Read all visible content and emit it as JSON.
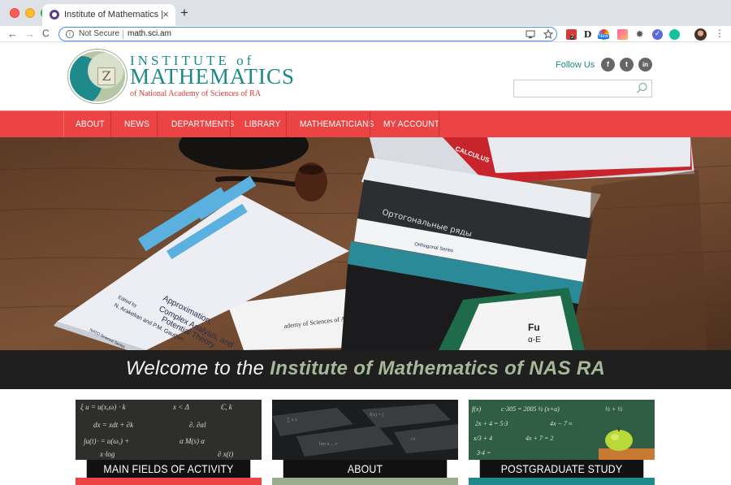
{
  "browser": {
    "tab_title": "Institute of Mathematics |",
    "tab_close": "×",
    "new_tab": "+",
    "back": "←",
    "forward": "→",
    "reload": "C",
    "info_glyph": "i",
    "security_label": "Not Secure",
    "url": "math.sci.am",
    "extensions": [
      "ext-red",
      "ext-disconnect",
      "ext-new",
      "ext-gradient",
      "ext-gear",
      "ext-check",
      "ext-grammarly",
      "avatar"
    ],
    "badges": {
      "ext_red": "2",
      "ext_new": "New"
    },
    "menu": "⋮"
  },
  "header": {
    "logo_line1": "INSTITUTE of",
    "logo_line2": "MATHEMATICS",
    "logo_line3": "of National Academy of Sciences of RA",
    "logo_glyph": "Z",
    "follow_us": "Follow Us",
    "social": [
      "f",
      "t",
      "in"
    ],
    "search_placeholder": ""
  },
  "nav": {
    "items": [
      "ABOUT",
      "NEWS",
      "DEPARTMENTS",
      "LIBRARY",
      "MATHEMATICIANS",
      "MY ACCOUNT"
    ]
  },
  "hero": {
    "book1_title": "Approximation, Complex Analysis, and Potential Theory",
    "book1_authors": "N. Arakelian and P.M. Gauthier",
    "book1_edited": "Edited by",
    "book1_series": "NATO Science Series",
    "book2_text": "ademy of Sciences of Armenia",
    "spine_text": "Ортогональные ряды",
    "orthogonal_series": "Orthogonal Series",
    "calculus": "CALCULUS",
    "welcome_prefix": "Welcome to the ",
    "welcome_accent": "Institute of Mathematics of NAS RA"
  },
  "cards": [
    {
      "label": "MAIN FIELDS OF ACTIVITY",
      "strip": "#ec4444"
    },
    {
      "label": "ABOUT",
      "strip": "#9aae8e"
    },
    {
      "label": "POSTGRADUATE STUDY",
      "strip": "#1f8a8c"
    }
  ],
  "colors": {
    "nav_red": "#ec4444",
    "brand_teal": "#1a8a87",
    "accent_green": "#a6b89a"
  }
}
